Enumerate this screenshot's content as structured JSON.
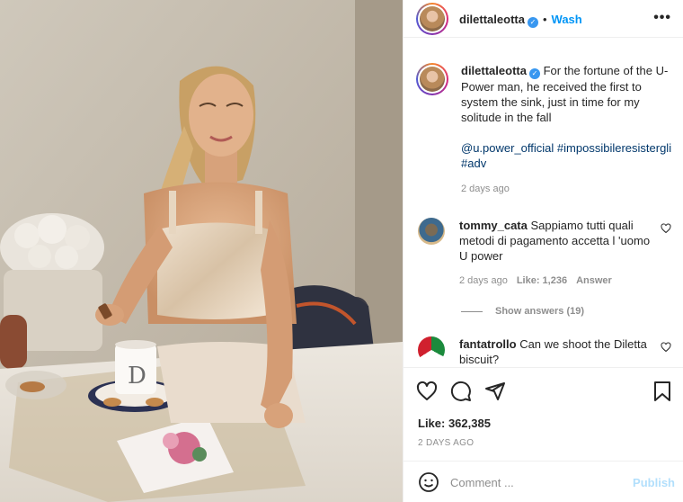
{
  "post": {
    "author": "dilettaleotta",
    "verified_mark": "✓",
    "dot": "•",
    "follow_label": "Wash",
    "more_label": "•••"
  },
  "caption": {
    "author": "dilettaleotta",
    "text": "For the fortune of the U-Power man, he received the first to system the sink, just in time for my solitude in the fall",
    "tags": [
      "@u.power_official",
      "#impossibileresistergli",
      "#adv"
    ],
    "time": "2 days ago"
  },
  "comments": [
    {
      "user": "tommy_cata",
      "text": "Sappiamo tutti quali metodi di pagamento accetta l 'uomo U power",
      "time": "2 days ago",
      "likes": "Like: 1,236",
      "reply_label": "Answer",
      "show_answers": "Show answers (19)"
    },
    {
      "user": "fantatrollo",
      "text": "Can we shoot the Diletta biscuit?"
    }
  ],
  "actions": {
    "likes": "Like: 362,385",
    "date": "2 DAYS AGO"
  },
  "composer": {
    "placeholder": "Comment ...",
    "publish_label": "Publish"
  },
  "icons": [
    "heart-icon",
    "comment-icon",
    "share-icon",
    "bookmark-icon",
    "smile-icon",
    "more-icon",
    "verified-icon"
  ],
  "colors": {
    "link": "#0095f6",
    "hashtag": "#00376b",
    "meta": "#8e8e8e",
    "publish_disabled": "#b2dffc"
  }
}
